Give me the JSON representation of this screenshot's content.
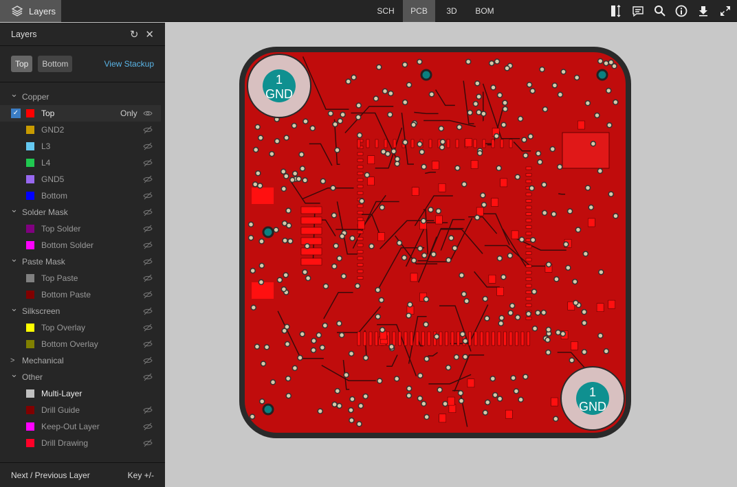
{
  "topbar": {
    "layers_tab": "Layers",
    "views": [
      "SCH",
      "PCB",
      "3D",
      "BOM"
    ],
    "active_view": "PCB"
  },
  "panel": {
    "title": "Layers",
    "top_btn": "Top",
    "bottom_btn": "Bottom",
    "view_stackup": "View Stackup",
    "only_label": "Only",
    "groups": [
      {
        "name": "Copper",
        "open": true,
        "items": [
          {
            "name": "Top",
            "color": "#ff0000",
            "visible": true,
            "checked": true
          },
          {
            "name": "GND2",
            "color": "#c89b00"
          },
          {
            "name": "L3",
            "color": "#64c8f0"
          },
          {
            "name": "L4",
            "color": "#20c850"
          },
          {
            "name": "GND5",
            "color": "#9868f0"
          },
          {
            "name": "Bottom",
            "color": "#0000ff"
          }
        ]
      },
      {
        "name": "Solder Mask",
        "open": true,
        "items": [
          {
            "name": "Top Solder",
            "color": "#800080"
          },
          {
            "name": "Bottom Solder",
            "color": "#ff00ff"
          }
        ]
      },
      {
        "name": "Paste Mask",
        "open": true,
        "items": [
          {
            "name": "Top Paste",
            "color": "#808080"
          },
          {
            "name": "Bottom Paste",
            "color": "#800000"
          }
        ]
      },
      {
        "name": "Silkscreen",
        "open": true,
        "items": [
          {
            "name": "Top Overlay",
            "color": "#ffff00"
          },
          {
            "name": "Bottom Overlay",
            "color": "#808000"
          }
        ]
      },
      {
        "name": "Mechanical",
        "open": false,
        "items": []
      },
      {
        "name": "Other",
        "open": true,
        "items": [
          {
            "name": "Multi-Layer",
            "color": "#c0c0c0",
            "visible": true,
            "noeye": true
          },
          {
            "name": "Drill Guide",
            "color": "#800000"
          },
          {
            "name": "Keep-Out Layer",
            "color": "#ff00ff"
          },
          {
            "name": "Drill Drawing",
            "color": "#ff0028"
          }
        ]
      }
    ],
    "footer_label": "Next / Previous Layer",
    "footer_key": "Key +/-"
  },
  "pcb": {
    "hole_net": "1",
    "hole_label": "GND",
    "board_color": "#c00c0c",
    "border_color": "#2a2a2a"
  }
}
